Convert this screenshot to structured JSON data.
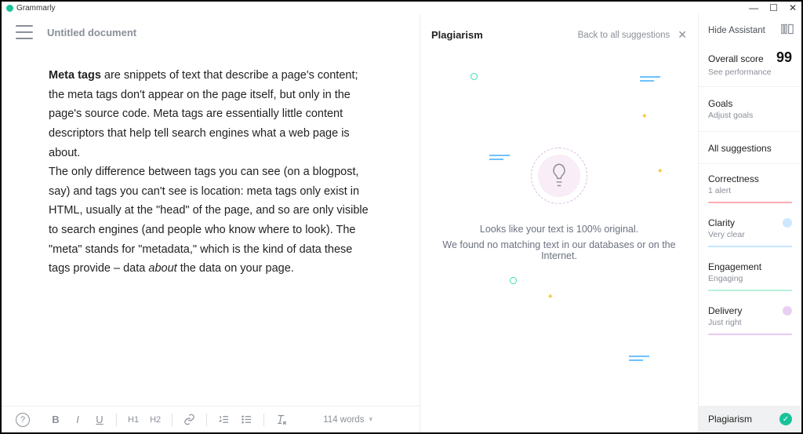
{
  "titlebar": {
    "app_name": "Grammarly"
  },
  "editor": {
    "doc_title": "Untitled document",
    "body_bold": "Meta tags",
    "body_p1": " are snippets of text that describe a page's content; the meta tags don't appear on the page itself, but only in the page's source code. Meta tags are essentially little content descriptors that help tell search engines what a web page is about.",
    "body_p2a": "The only difference between tags you can see (on a blogpost, say) and tags you can't see is location: meta tags only exist in HTML, usually at the \"head\" of the page, and so are only visible to search engines (and people who know where to look). The \"meta\" stands for \"metadata,\" which is the kind of data these tags provide – data ",
    "body_italic": "about",
    "body_p2b": " the data on your page.",
    "word_count": "114 words",
    "toolbar": {
      "h1": "H1",
      "h2": "H2"
    }
  },
  "plag": {
    "title": "Plagiarism",
    "back": "Back to all suggestions",
    "line1": "Looks like your text is 100% original.",
    "line2": "We found no matching text in our databases or on the Internet."
  },
  "side": {
    "hide": "Hide Assistant",
    "score_label": "Overall score",
    "score": "99",
    "score_sub": "See performance",
    "goals_title": "Goals",
    "goals_sub": "Adjust goals",
    "all_sug": "All suggestions",
    "correctness": {
      "title": "Correctness",
      "sub": "1 alert"
    },
    "clarity": {
      "title": "Clarity",
      "sub": "Very clear"
    },
    "engagement": {
      "title": "Engagement",
      "sub": "Engaging"
    },
    "delivery": {
      "title": "Delivery",
      "sub": "Just right"
    },
    "plag_button": "Plagiarism"
  }
}
